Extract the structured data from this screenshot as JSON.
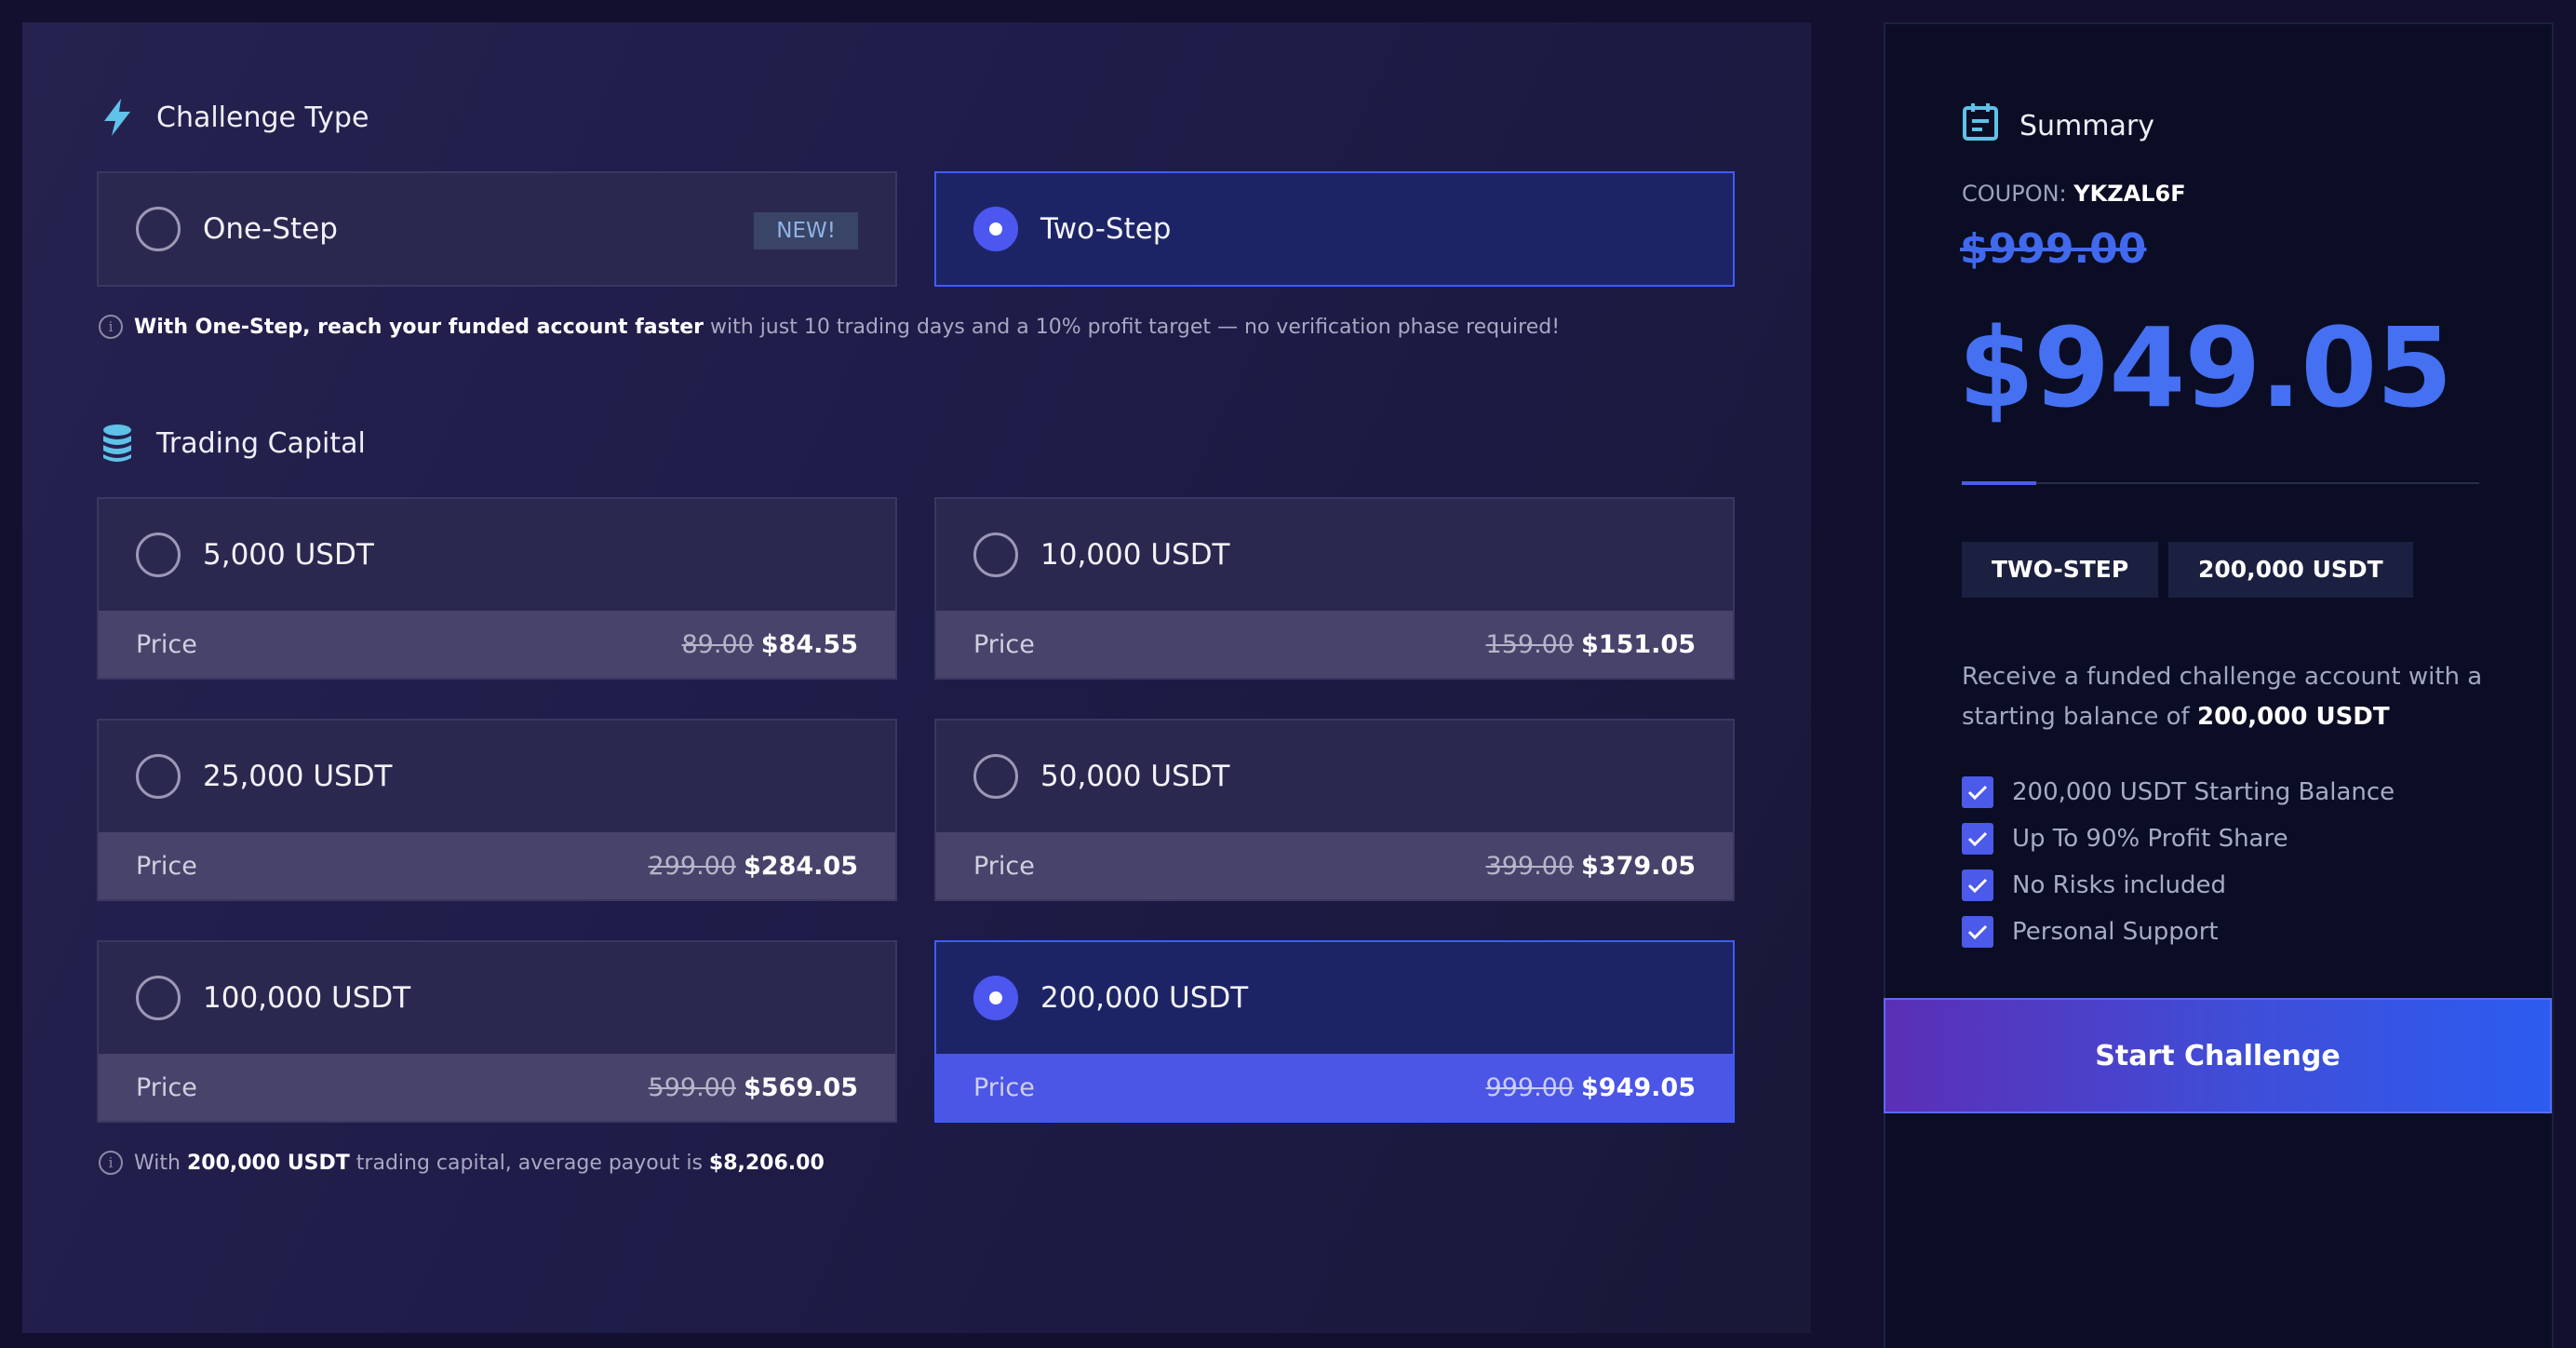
{
  "challenge": {
    "title": "Challenge Type",
    "options": [
      {
        "label": "One-Step",
        "badge": "NEW!",
        "selected": false
      },
      {
        "label": "Two-Step",
        "selected": true
      }
    ],
    "info_bold": "With One-Step, reach your funded account faster",
    "info_rest": "with just 10 trading days and a 10% profit target — no verification phase required!"
  },
  "capital": {
    "title": "Trading Capital",
    "price_label": "Price",
    "options": [
      {
        "label": "5,000 USDT",
        "old": "89.00",
        "new": "$84.55",
        "selected": false
      },
      {
        "label": "10,000 USDT",
        "old": "159.00",
        "new": "$151.05",
        "selected": false
      },
      {
        "label": "25,000 USDT",
        "old": "299.00",
        "new": "$284.05",
        "selected": false
      },
      {
        "label": "50,000 USDT",
        "old": "399.00",
        "new": "$379.05",
        "selected": false
      },
      {
        "label": "100,000 USDT",
        "old": "599.00",
        "new": "$569.05",
        "selected": false
      },
      {
        "label": "200,000 USDT",
        "old": "999.00",
        "new": "$949.05",
        "selected": true
      }
    ],
    "info_pre": "With",
    "info_capital": "200,000 USDT",
    "info_mid": "trading capital, average payout is",
    "info_payout": "$8,206.00"
  },
  "summary": {
    "title": "Summary",
    "coupon_label": "COUPON:",
    "coupon_code": "YKZAL6F",
    "old_total": "$999.00",
    "total": "$949.05",
    "tag_type": "TWO-STEP",
    "tag_capital": "200,000 USDT",
    "desc_text": "Receive a funded challenge account with a starting balance of",
    "desc_bold": "200,000 USDT",
    "features": [
      "200,000 USDT Starting Balance",
      "Up To 90% Profit Share",
      "No Risks included",
      "Personal Support"
    ],
    "cta": "Start Challenge"
  },
  "colors": {
    "accent": "#4b57ef",
    "selected_border": "#3f5bff",
    "price_blue": "#4570f2"
  }
}
